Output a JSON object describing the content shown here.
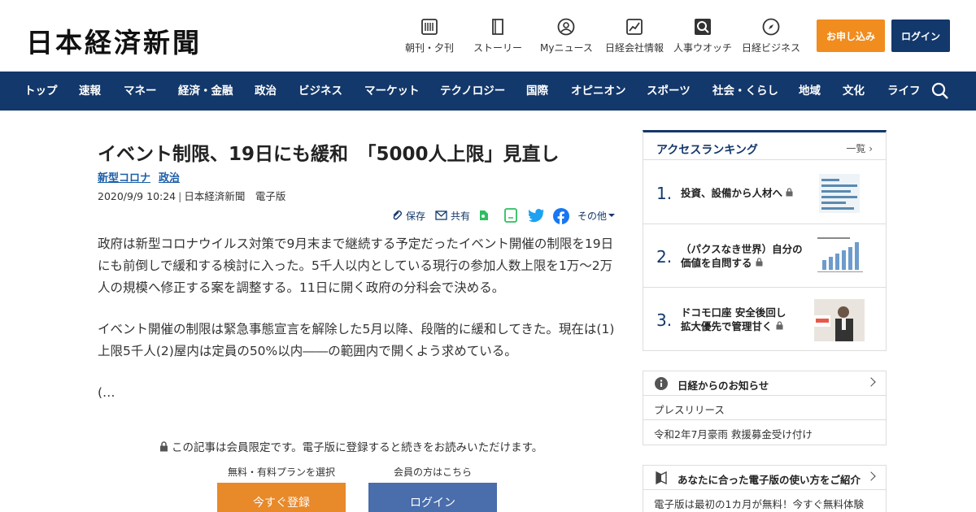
{
  "header": {
    "logo": "日本経済新聞",
    "nav": [
      {
        "label": "朝刊・夕刊",
        "icon": "newspaper-icon"
      },
      {
        "label": "ストーリー",
        "icon": "book-icon"
      },
      {
        "label": "Myニュース",
        "icon": "user-icon"
      },
      {
        "label": "日経会社情報",
        "icon": "chart-icon"
      },
      {
        "label": "人事ウオッチ",
        "icon": "magnifier-icon"
      },
      {
        "label": "日経ビジネス",
        "icon": "compass-icon"
      }
    ],
    "apply_label": "お申し込み",
    "login_label": "ログイン"
  },
  "navbar": {
    "items": [
      "トップ",
      "速報",
      "マネー",
      "経済・金融",
      "政治",
      "ビジネス",
      "マーケット",
      "テクノロジー",
      "国際",
      "オピニオン",
      "スポーツ",
      "社会・くらし",
      "地域",
      "文化",
      "ライフ"
    ]
  },
  "article": {
    "title": "イベント制限、19日にも緩和　「5000人上限」見直し",
    "tags": [
      "新型コロナ",
      "政治"
    ],
    "date": "2020/9/9 10:24",
    "source": "日本経済新聞　電子版",
    "tools": {
      "save": "保存",
      "share": "共有",
      "other": "その他"
    },
    "paragraphs": [
      "政府は新型コロナウイルス対策で9月末まで継続する予定だったイベント開催の制限を19日にも前倒しで緩和する検討に入った。5千人以内としている現行の参加人数上限を1万～2万人の規模へ修正する案を調整する。11日に開く政府の分科会で決める。",
      "イベント開催の制限は緊急事態宣言を解除した5月以降、段階的に緩和してきた。現在は(1)上限5千人(2)屋内は定員の50%以内――の範囲内で開くよう求めている。",
      "(…"
    ],
    "paywall_msg": "この記事は会員限定です。電子版に登録すると続きをお読みいただけます。",
    "plan_label": "無料・有料プランを選択",
    "member_label": "会員の方はこちら",
    "register_button": "今すぐ登録",
    "login_button": "ログイン"
  },
  "ranking": {
    "title": "アクセスランキング",
    "more": "一覧",
    "items": [
      {
        "num": "1.",
        "text": "投資、設備から人材へ"
      },
      {
        "num": "2.",
        "text": "（パクスなき世界）自分の価値を自問する"
      },
      {
        "num": "3.",
        "text": "ドコモ口座 安全後回し　拡大優先で管理甘く"
      }
    ]
  },
  "info": {
    "title": "日経からのお知らせ",
    "rows": [
      "プレスリリース",
      "令和2年7月豪雨 救援募金受け付け"
    ]
  },
  "guide": {
    "title": "あなたに合った電子版の使い方をご紹介",
    "rows": [
      "電子版は最初の1カ月が無料！今すぐ無料体験"
    ]
  },
  "colors": {
    "navy": "#13386b",
    "orange": "#f18c1e",
    "link": "#1a5ea8"
  }
}
